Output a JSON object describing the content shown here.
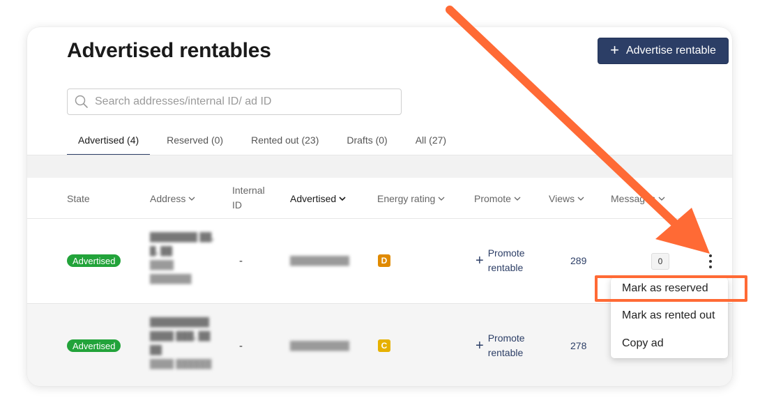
{
  "header": {
    "title": "Advertised rentables",
    "primary_button": {
      "label": "Advertise rentable",
      "icon": "plus-icon"
    }
  },
  "search": {
    "placeholder": "Search addresses/internal ID/ ad ID",
    "value": "",
    "icon": "search-icon"
  },
  "tabs": [
    {
      "label": "Advertised (4)",
      "active": true
    },
    {
      "label": "Reserved (0)",
      "active": false
    },
    {
      "label": "Rented out (23)",
      "active": false
    },
    {
      "label": "Drafts (0)",
      "active": false
    },
    {
      "label": "All (27)",
      "active": false
    }
  ],
  "table": {
    "columns": {
      "state": "State",
      "address": "Address",
      "internal_id_line1": "Internal",
      "internal_id_line2": "ID",
      "advertised": "Advertised",
      "energy_rating": "Energy rating",
      "promote": "Promote",
      "views": "Views",
      "messages": "Messages"
    },
    "rows": [
      {
        "state": "Advertised",
        "internal_id": "-",
        "energy_rating": "D",
        "energy_color": "#e08a00",
        "promote_line1": "Promote",
        "promote_line2": "rentable",
        "views": "289",
        "messages": "0"
      },
      {
        "state": "Advertised",
        "internal_id": "-",
        "energy_rating": "C",
        "energy_color": "#e6b100",
        "promote_line1": "Promote",
        "promote_line2": "rentable",
        "views": "278"
      }
    ]
  },
  "context_menu": {
    "items": [
      "Mark as reserved",
      "Mark as rented out",
      "Copy ad"
    ],
    "highlighted": "Mark as reserved"
  },
  "colors": {
    "accent": "#2c3e66",
    "status_green": "#22a33a",
    "annotation": "#ff6a35"
  }
}
